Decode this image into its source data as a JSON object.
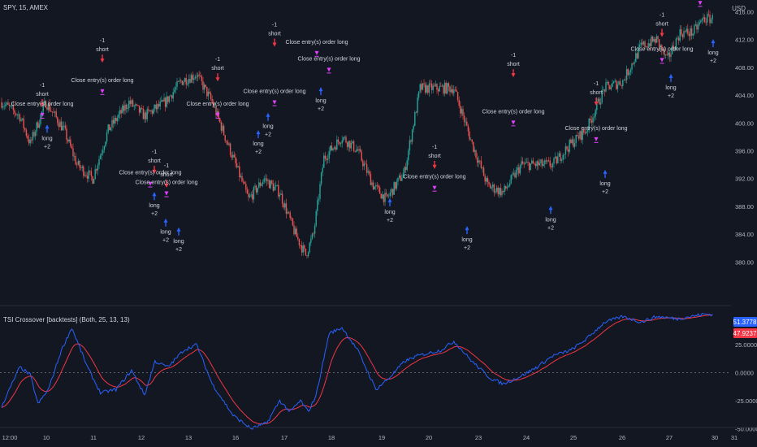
{
  "header": {
    "symbol_line": "SPY, 15, AMEX",
    "currency": "USD"
  },
  "indicator": {
    "title": "TSI Crossover [backtests] (Both, 25, 13, 13)",
    "tsi_value": "51.3778",
    "signal_value": "47.9237",
    "tsi_color": "#2962ff",
    "signal_color": "#f23645"
  },
  "colors": {
    "background": "#131722",
    "up": "#26a69a",
    "down": "#ef5350",
    "short_arrow": "#f23645",
    "long_arrow": "#2962ff",
    "close_marker": "#e040fb",
    "text": "#d1d4dc"
  },
  "price_axis": {
    "labels": [
      "416.00",
      "412.00",
      "408.00",
      "404.00",
      "400.00",
      "396.00",
      "392.00",
      "388.00",
      "384.00",
      "380.00"
    ],
    "values": [
      416,
      412,
      408,
      404,
      400,
      396,
      392,
      388,
      384,
      380
    ]
  },
  "ind_axis": {
    "labels": [
      "25.0000",
      "0.0000",
      "-25.0000",
      "-50.0000"
    ],
    "values": [
      25,
      0,
      -25,
      -50
    ]
  },
  "time_axis": {
    "labels": [
      "12:00",
      "10",
      "11",
      "12",
      "13",
      "16",
      "17",
      "18",
      "19",
      "20",
      "23",
      "24",
      "25",
      "26",
      "27",
      "30",
      "31"
    ]
  },
  "chart_data": {
    "type": "candlestick",
    "price_waypoints": [
      [
        0,
        403
      ],
      [
        14,
        401
      ],
      [
        22,
        397
      ],
      [
        34,
        403
      ],
      [
        48,
        399
      ],
      [
        58,
        394
      ],
      [
        70,
        392
      ],
      [
        82,
        399
      ],
      [
        98,
        403
      ],
      [
        110,
        401
      ],
      [
        126,
        403
      ],
      [
        138,
        406
      ],
      [
        150,
        407
      ],
      [
        162,
        403
      ],
      [
        176,
        396
      ],
      [
        190,
        389
      ],
      [
        202,
        392
      ],
      [
        214,
        390
      ],
      [
        226,
        384
      ],
      [
        234,
        381
      ],
      [
        240,
        384
      ],
      [
        248,
        395
      ],
      [
        262,
        398
      ],
      [
        274,
        396
      ],
      [
        286,
        391
      ],
      [
        296,
        389
      ],
      [
        310,
        393
      ],
      [
        322,
        405
      ],
      [
        338,
        405
      ],
      [
        348,
        405
      ],
      [
        362,
        397
      ],
      [
        374,
        391
      ],
      [
        386,
        390
      ],
      [
        400,
        394
      ],
      [
        412,
        394
      ],
      [
        424,
        394
      ],
      [
        438,
        397
      ],
      [
        450,
        399
      ],
      [
        464,
        405
      ],
      [
        478,
        406
      ],
      [
        492,
        411
      ],
      [
        504,
        412
      ],
      [
        512,
        409
      ],
      [
        522,
        413
      ],
      [
        532,
        413
      ],
      [
        540,
        415
      ]
    ],
    "tsi_waypoints": [
      [
        0,
        -30
      ],
      [
        14,
        5
      ],
      [
        22,
        -2
      ],
      [
        28,
        -28
      ],
      [
        36,
        -15
      ],
      [
        46,
        20
      ],
      [
        54,
        40
      ],
      [
        66,
        5
      ],
      [
        76,
        -18
      ],
      [
        88,
        -15
      ],
      [
        100,
        2
      ],
      [
        110,
        -20
      ],
      [
        118,
        10
      ],
      [
        128,
        5
      ],
      [
        140,
        20
      ],
      [
        150,
        25
      ],
      [
        162,
        -10
      ],
      [
        178,
        -38
      ],
      [
        192,
        -50
      ],
      [
        204,
        -45
      ],
      [
        214,
        -25
      ],
      [
        222,
        -35
      ],
      [
        230,
        -25
      ],
      [
        236,
        -35
      ],
      [
        242,
        -20
      ],
      [
        252,
        35
      ],
      [
        262,
        40
      ],
      [
        274,
        20
      ],
      [
        288,
        -15
      ],
      [
        298,
        -5
      ],
      [
        310,
        10
      ],
      [
        320,
        15
      ],
      [
        338,
        20
      ],
      [
        348,
        28
      ],
      [
        362,
        10
      ],
      [
        376,
        -5
      ],
      [
        386,
        -10
      ],
      [
        400,
        -3
      ],
      [
        412,
        5
      ],
      [
        424,
        15
      ],
      [
        438,
        20
      ],
      [
        450,
        30
      ],
      [
        464,
        45
      ],
      [
        478,
        50
      ],
      [
        492,
        45
      ],
      [
        504,
        50
      ],
      [
        520,
        48
      ],
      [
        540,
        52
      ]
    ],
    "tsi_value": 51.3778,
    "signal_value": 47.9237,
    "ylim": [
      378,
      418
    ],
    "ind_ylim": [
      -55,
      60
    ]
  },
  "signals": [
    {
      "type": "short",
      "bar": 52,
      "price": 405.2,
      "upper": "-1",
      "lower": "short"
    },
    {
      "type": "close",
      "bar": 52,
      "price": 402.5,
      "text": "Close entry(s) order long"
    },
    {
      "type": "long",
      "bar": 58,
      "price": 398.6,
      "upper": "long",
      "lower": "+2"
    },
    {
      "type": "short",
      "bar": 126,
      "price": 411.6,
      "upper": "-1",
      "lower": "short"
    },
    {
      "type": "close",
      "bar": 126,
      "price": 405.9,
      "text": "Close entry(s) order long"
    },
    {
      "type": "short",
      "bar": 190,
      "price": 395.6,
      "upper": "-1",
      "lower": "short"
    },
    {
      "type": "short",
      "bar": 205,
      "price": 393.6,
      "upper": "-1",
      "lower": "short"
    },
    {
      "type": "close",
      "bar": 185,
      "price": 392.6,
      "text": "Close entry(s) order long"
    },
    {
      "type": "close",
      "bar": 205,
      "price": 391.2,
      "text": "Close entry(s) order long"
    },
    {
      "type": "long",
      "bar": 190,
      "price": 388.9,
      "upper": "long",
      "lower": "+2"
    },
    {
      "type": "long",
      "bar": 204,
      "price": 385.1,
      "upper": "long",
      "lower": "+2"
    },
    {
      "type": "long",
      "bar": 220,
      "price": 383.8,
      "upper": "long",
      "lower": "+2"
    },
    {
      "type": "short",
      "bar": 268,
      "price": 408.9,
      "upper": "-1",
      "lower": "short"
    },
    {
      "type": "close",
      "bar": 268,
      "price": 402.5,
      "text": "Close entry(s) order long"
    },
    {
      "type": "short",
      "bar": 338,
      "price": 413.9,
      "upper": "-1",
      "lower": "short"
    },
    {
      "type": "close",
      "bar": 338,
      "price": 404.3,
      "text": "Close entry(s) order long"
    },
    {
      "type": "long",
      "bar": 318,
      "price": 397.8,
      "upper": "long",
      "lower": "+2"
    },
    {
      "type": "short",
      "bar": 390,
      "price": 421.3,
      "upper": "-1",
      "lower": "short"
    },
    {
      "type": "close",
      "bar": 390,
      "price": 411.4,
      "text": "Close entry(s) order long"
    },
    {
      "type": "close",
      "bar": 405,
      "price": 409.0,
      "text": "Close entry(s) order long"
    },
    {
      "type": "long",
      "bar": 330,
      "price": 400.3,
      "upper": "long",
      "lower": "+2"
    },
    {
      "type": "long",
      "bar": 395,
      "price": 404.0,
      "upper": "long",
      "lower": "+2"
    },
    {
      "type": "short",
      "bar": 535,
      "price": 396.3,
      "upper": "-1",
      "lower": "short"
    },
    {
      "type": "close",
      "bar": 535,
      "price": 392.0,
      "text": "Close entry(s) order long"
    },
    {
      "type": "long",
      "bar": 480,
      "price": 388.0,
      "upper": "long",
      "lower": "+2"
    },
    {
      "type": "long",
      "bar": 575,
      "price": 384.0,
      "upper": "long",
      "lower": "+2"
    },
    {
      "type": "short",
      "bar": 632,
      "price": 409.5,
      "upper": "-1",
      "lower": "short"
    },
    {
      "type": "close",
      "bar": 632,
      "price": 401.4,
      "text": "Close entry(s) order long"
    },
    {
      "type": "long",
      "bar": 678,
      "price": 386.9,
      "upper": "long",
      "lower": "+2"
    },
    {
      "type": "short",
      "bar": 734,
      "price": 405.4,
      "upper": "-1",
      "lower": "short"
    },
    {
      "type": "close",
      "bar": 734,
      "price": 399.0,
      "text": "Close entry(s) order long"
    },
    {
      "type": "long",
      "bar": 745,
      "price": 392.1,
      "upper": "long",
      "lower": "+2"
    },
    {
      "type": "short",
      "bar": 815,
      "price": 415.3,
      "upper": "-1",
      "lower": "short"
    },
    {
      "type": "close",
      "bar": 815,
      "price": 410.4,
      "text": "Close entry(s) order long"
    },
    {
      "type": "long",
      "bar": 826,
      "price": 405.9,
      "upper": "long",
      "lower": "+2"
    },
    {
      "type": "short",
      "bar": 862,
      "price": 422.0,
      "upper": "-1",
      "lower": "short"
    },
    {
      "type": "close",
      "bar": 862,
      "price": 418.6,
      "text": "Close entry(s) order long"
    },
    {
      "type": "long",
      "bar": 878,
      "price": 410.9,
      "upper": "long",
      "lower": "+2"
    }
  ]
}
